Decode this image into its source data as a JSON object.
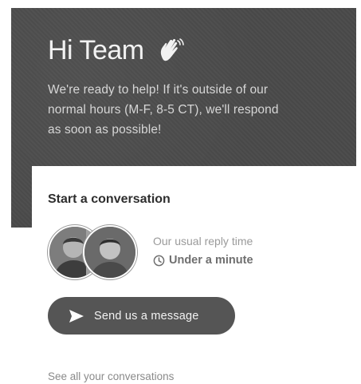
{
  "header": {
    "greeting": "Hi Team",
    "greeting_icon": "waving-hand-icon",
    "intro_line1": "We're ready to help! If it's outside of our",
    "intro_line2": "normal hours (M-F, 8-5 CT), we'll respond",
    "intro_line3": "as soon as possible!",
    "background_color": "#4a4a4a"
  },
  "card": {
    "title": "Start a conversation",
    "reply_label": "Our usual reply time",
    "reply_icon": "clock-icon",
    "reply_time": "Under a minute",
    "send_button_label": "Send us a message",
    "send_icon": "send-arrow-icon",
    "see_all_label": "See all your conversations"
  }
}
